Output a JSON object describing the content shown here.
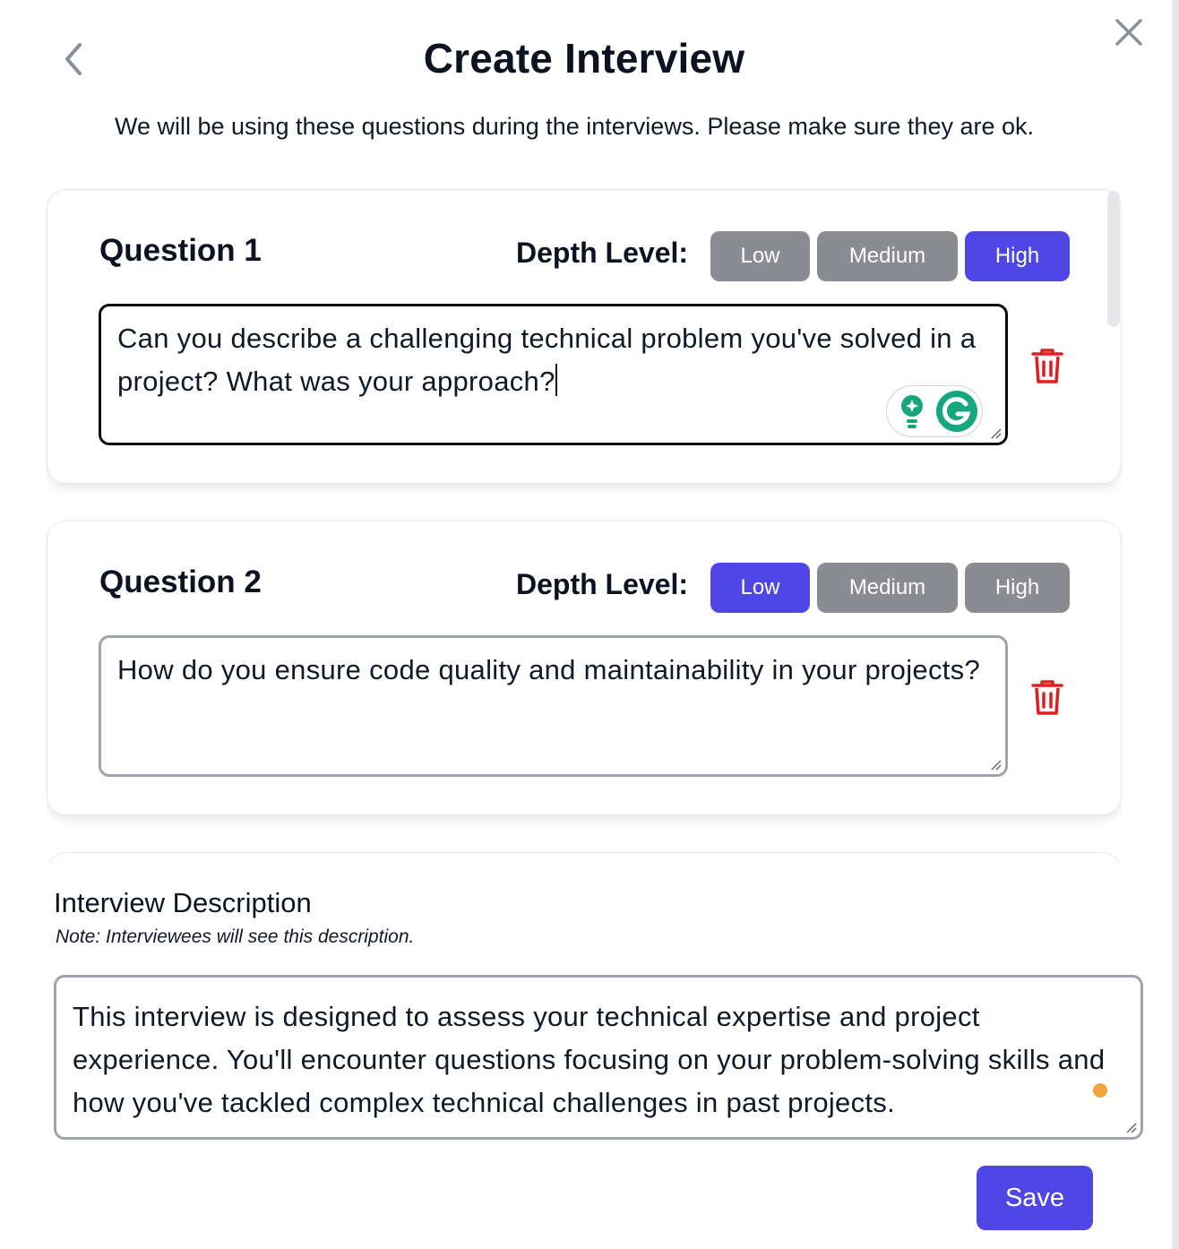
{
  "modal": {
    "title": "Create Interview",
    "subtitle": "We will be using these questions during the interviews. Please make sure they are ok.",
    "back_icon": "chevron-left-icon",
    "close_icon": "close-icon"
  },
  "depth_label": "Depth Level:",
  "depth_options": [
    "Low",
    "Medium",
    "High"
  ],
  "questions": [
    {
      "label": "Question 1",
      "depth": "High",
      "text": "Can you describe a challenging technical problem you've solved in a project? What was your approach?",
      "focused": true
    },
    {
      "label": "Question 2",
      "depth": "Low",
      "text": "How do you ensure code quality and maintainability in your projects?",
      "focused": false
    }
  ],
  "description": {
    "heading": "Interview Description",
    "note": "Note: Interviewees will see this description.",
    "text": "This interview is designed to assess your technical expertise and project experience. You'll encounter questions focusing on your problem-solving skills and how you've tackled complex technical challenges in past projects."
  },
  "actions": {
    "save_label": "Save"
  },
  "colors": {
    "accent": "#4f46e5",
    "inactive_button": "#8b8c92",
    "delete": "#e11d1d",
    "warning_dot": "#f2a33a"
  }
}
